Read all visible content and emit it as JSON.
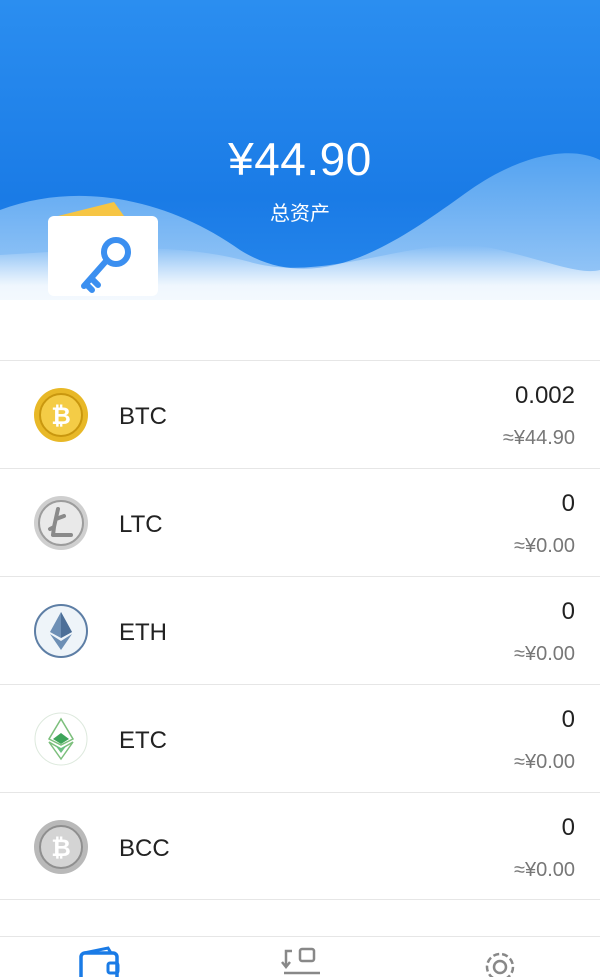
{
  "header": {
    "total_amount": "¥44.90",
    "total_label": "总资产",
    "accent_color": "#1a7be6"
  },
  "assets": [
    {
      "symbol": "BTC",
      "amount": "0.002",
      "value": "≈¥44.90",
      "icon": "bitcoin-icon"
    },
    {
      "symbol": "LTC",
      "amount": "0",
      "value": "≈¥0.00",
      "icon": "litecoin-icon"
    },
    {
      "symbol": "ETH",
      "amount": "0",
      "value": "≈¥0.00",
      "icon": "ethereum-icon"
    },
    {
      "symbol": "ETC",
      "amount": "0",
      "value": "≈¥0.00",
      "icon": "ethereum-classic-icon"
    },
    {
      "symbol": "BCC",
      "amount": "0",
      "value": "≈¥0.00",
      "icon": "bitcoin-cash-icon"
    }
  ],
  "tabbar": {
    "active_tab": "wallet",
    "active_color": "#1a7be6",
    "inactive_color": "#888888",
    "tabs": [
      {
        "id": "wallet",
        "icon": "wallet-icon"
      },
      {
        "id": "exchange",
        "icon": "exchange-icon"
      },
      {
        "id": "settings",
        "icon": "gear-icon"
      }
    ]
  }
}
